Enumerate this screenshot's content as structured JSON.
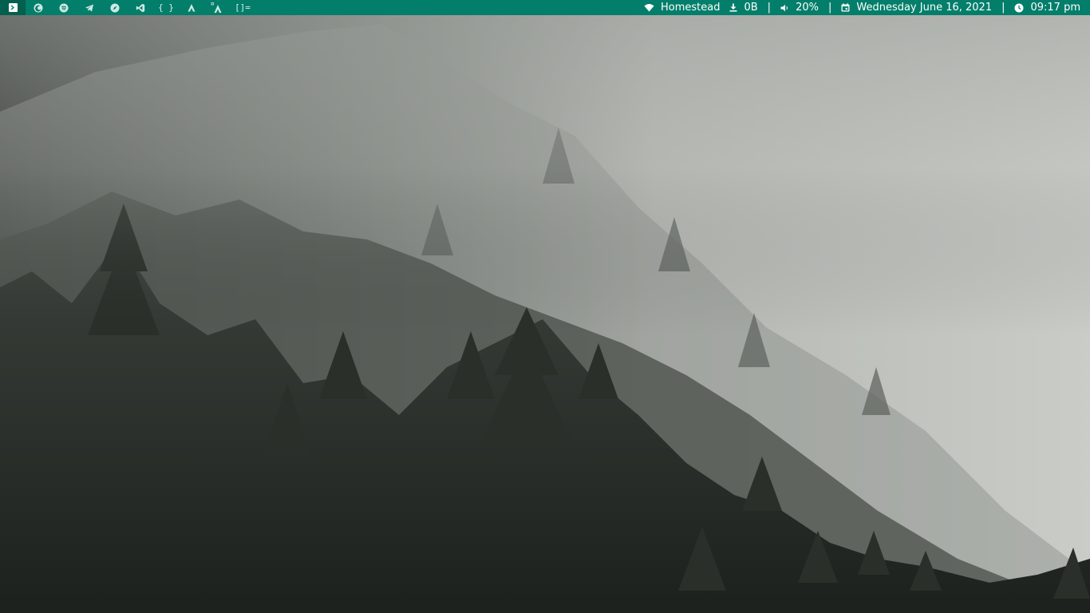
{
  "taskbar": {
    "apps": [
      {
        "icon": "terminal-launcher-icon"
      },
      {
        "icon": "firefox-icon"
      },
      {
        "icon": "spotify-icon"
      },
      {
        "icon": "telegram-icon"
      },
      {
        "icon": "compass-icon"
      },
      {
        "icon": "vscode-icon"
      },
      {
        "icon": "braces-icon",
        "label": "{ }"
      },
      {
        "icon": "inkscape-icon"
      },
      {
        "icon": "font-manager-icon"
      },
      {
        "icon": "layout-icon",
        "label": "[]="
      }
    ],
    "status": {
      "network": {
        "icon": "wifi-icon",
        "label": "Homestead"
      },
      "download": {
        "icon": "download-icon",
        "label": "0B"
      },
      "volume": {
        "icon": "volume-icon",
        "label": "20%"
      },
      "date": {
        "icon": "calendar-icon",
        "label": "Wednesday June 16, 2021"
      },
      "time": {
        "icon": "clock-icon",
        "label": "09:17 pm"
      },
      "separator": "|"
    }
  },
  "colors": {
    "bar": "#037e6b",
    "bar_text": "#ffffff"
  },
  "wallpaper": {
    "subject": "misty-forest"
  }
}
